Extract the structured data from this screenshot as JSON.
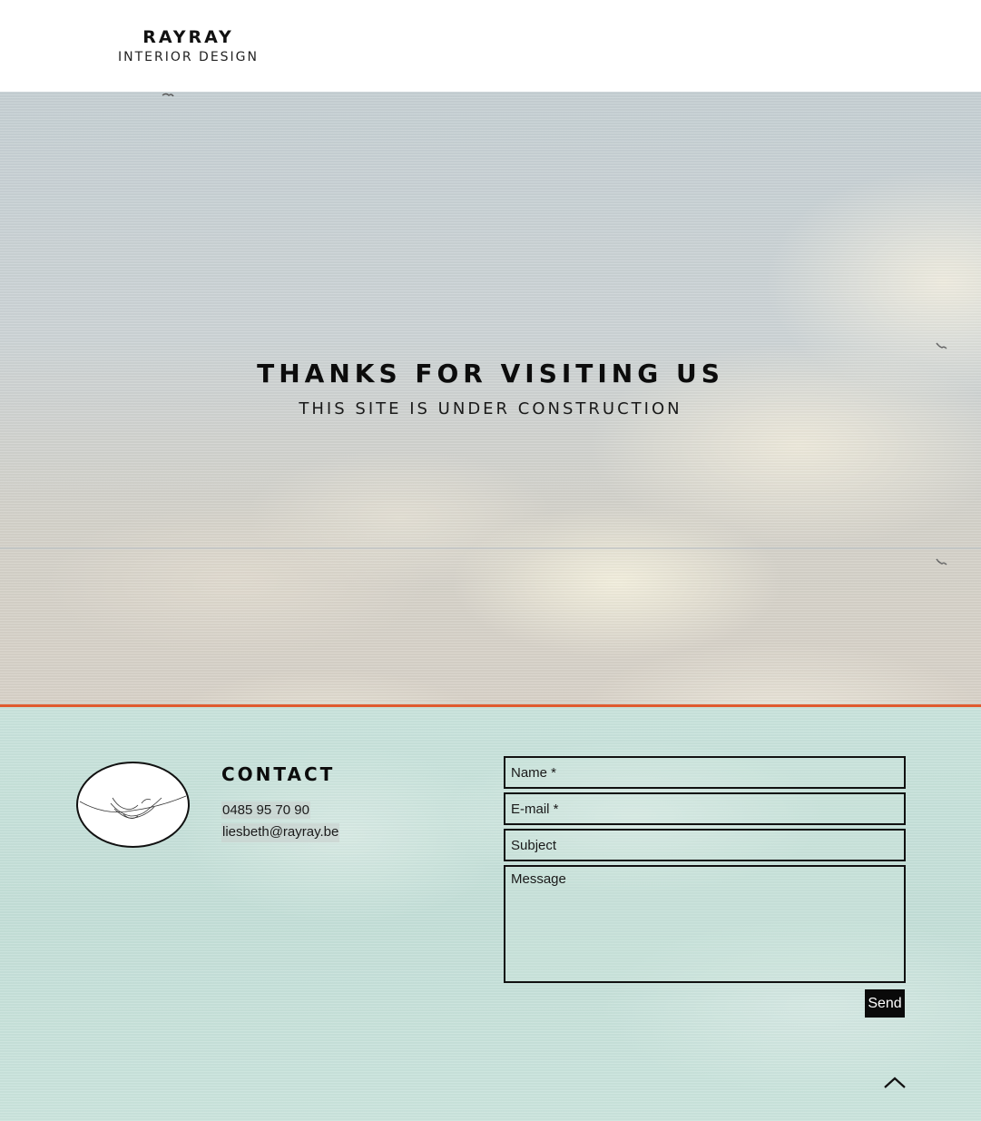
{
  "header": {
    "logo_title": "RAYRAY",
    "logo_subtitle": "INTERIOR DESIGN"
  },
  "hero": {
    "title": "THANKS FOR VISITING US",
    "subtitle": "THIS SITE IS UNDER CONSTRUCTION"
  },
  "contact": {
    "heading": "CONTACT",
    "phone": "0485 95 70 90",
    "email": "liesbeth@rayray.be",
    "logo_icon": "line-drawing-icon"
  },
  "form": {
    "name_placeholder": "Name *",
    "email_placeholder": "E-mail *",
    "subject_placeholder": "Subject",
    "message_placeholder": "Message",
    "send_label": "Send"
  },
  "icons": {
    "back_to_top": "chevron-up-icon",
    "bird": "bird-icon"
  },
  "colors": {
    "divider": "#e05a2e",
    "footer_bg": "#c6e0d9",
    "button_bg": "#0a0a0a"
  }
}
